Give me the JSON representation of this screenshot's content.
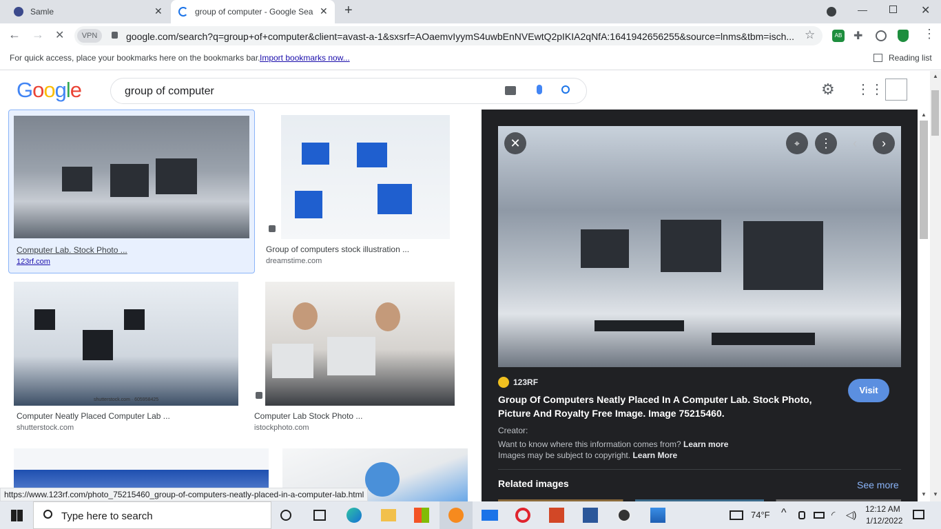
{
  "browser": {
    "tabs": [
      {
        "title": "Samle"
      },
      {
        "title": "group of computer - Google Sea"
      }
    ],
    "url": "google.com/search?q=group+of+computer&client=avast-a-1&sxsrf=AOaemvIyymS4uwbEnNVEwtQ2pIKIA2qNfA:1641942656255&source=lnms&tbm=isch...",
    "vpn_label": "VPN",
    "bookmarks_hint": "For quick access, place your bookmarks here on the bookmarks bar.",
    "import_bookmarks": "Import bookmarks now...",
    "reading_list": "Reading list",
    "profile_badge": "AB",
    "status_url": "https://www.123rf.com/photo_75215460_group-of-computers-neatly-placed-in-a-computer-lab.html"
  },
  "google": {
    "logo_letters": [
      "G",
      "o",
      "o",
      "g",
      "l",
      "e"
    ],
    "logo_colors": [
      "#4285f4",
      "#ea4335",
      "#fbbc05",
      "#4285f4",
      "#34a853",
      "#ea4335"
    ],
    "query": "group of computer"
  },
  "results": [
    {
      "title": "Computer Lab. Stock Photo ...",
      "source": "123rf.com"
    },
    {
      "title": "Group of computers stock illustration ...",
      "source": "dreamstime.com"
    },
    {
      "title": "Computer Neatly Placed Computer Lab ...",
      "source": "shutterstock.com",
      "watermark": "shutterstock.com · 605958425"
    },
    {
      "title": "Computer Lab Stock Photo ...",
      "source": "istockphoto.com"
    }
  ],
  "preview": {
    "site": "123RF",
    "title": "Group Of Computers Neatly Placed In A Computer Lab. Stock Photo, Picture And Royalty Free Image. Image 75215460.",
    "visit": "Visit",
    "creator": "Creator:",
    "info": "Want to know where this information comes from?",
    "learn_more": "Learn more",
    "copyright": "Images may be subject to copyright.",
    "learn_more2": "Learn More",
    "related": "Related images",
    "see_more": "See more"
  },
  "taskbar": {
    "search_placeholder": "Type here to search",
    "weather": "74°F",
    "time": "12:12 AM",
    "date": "1/12/2022"
  }
}
